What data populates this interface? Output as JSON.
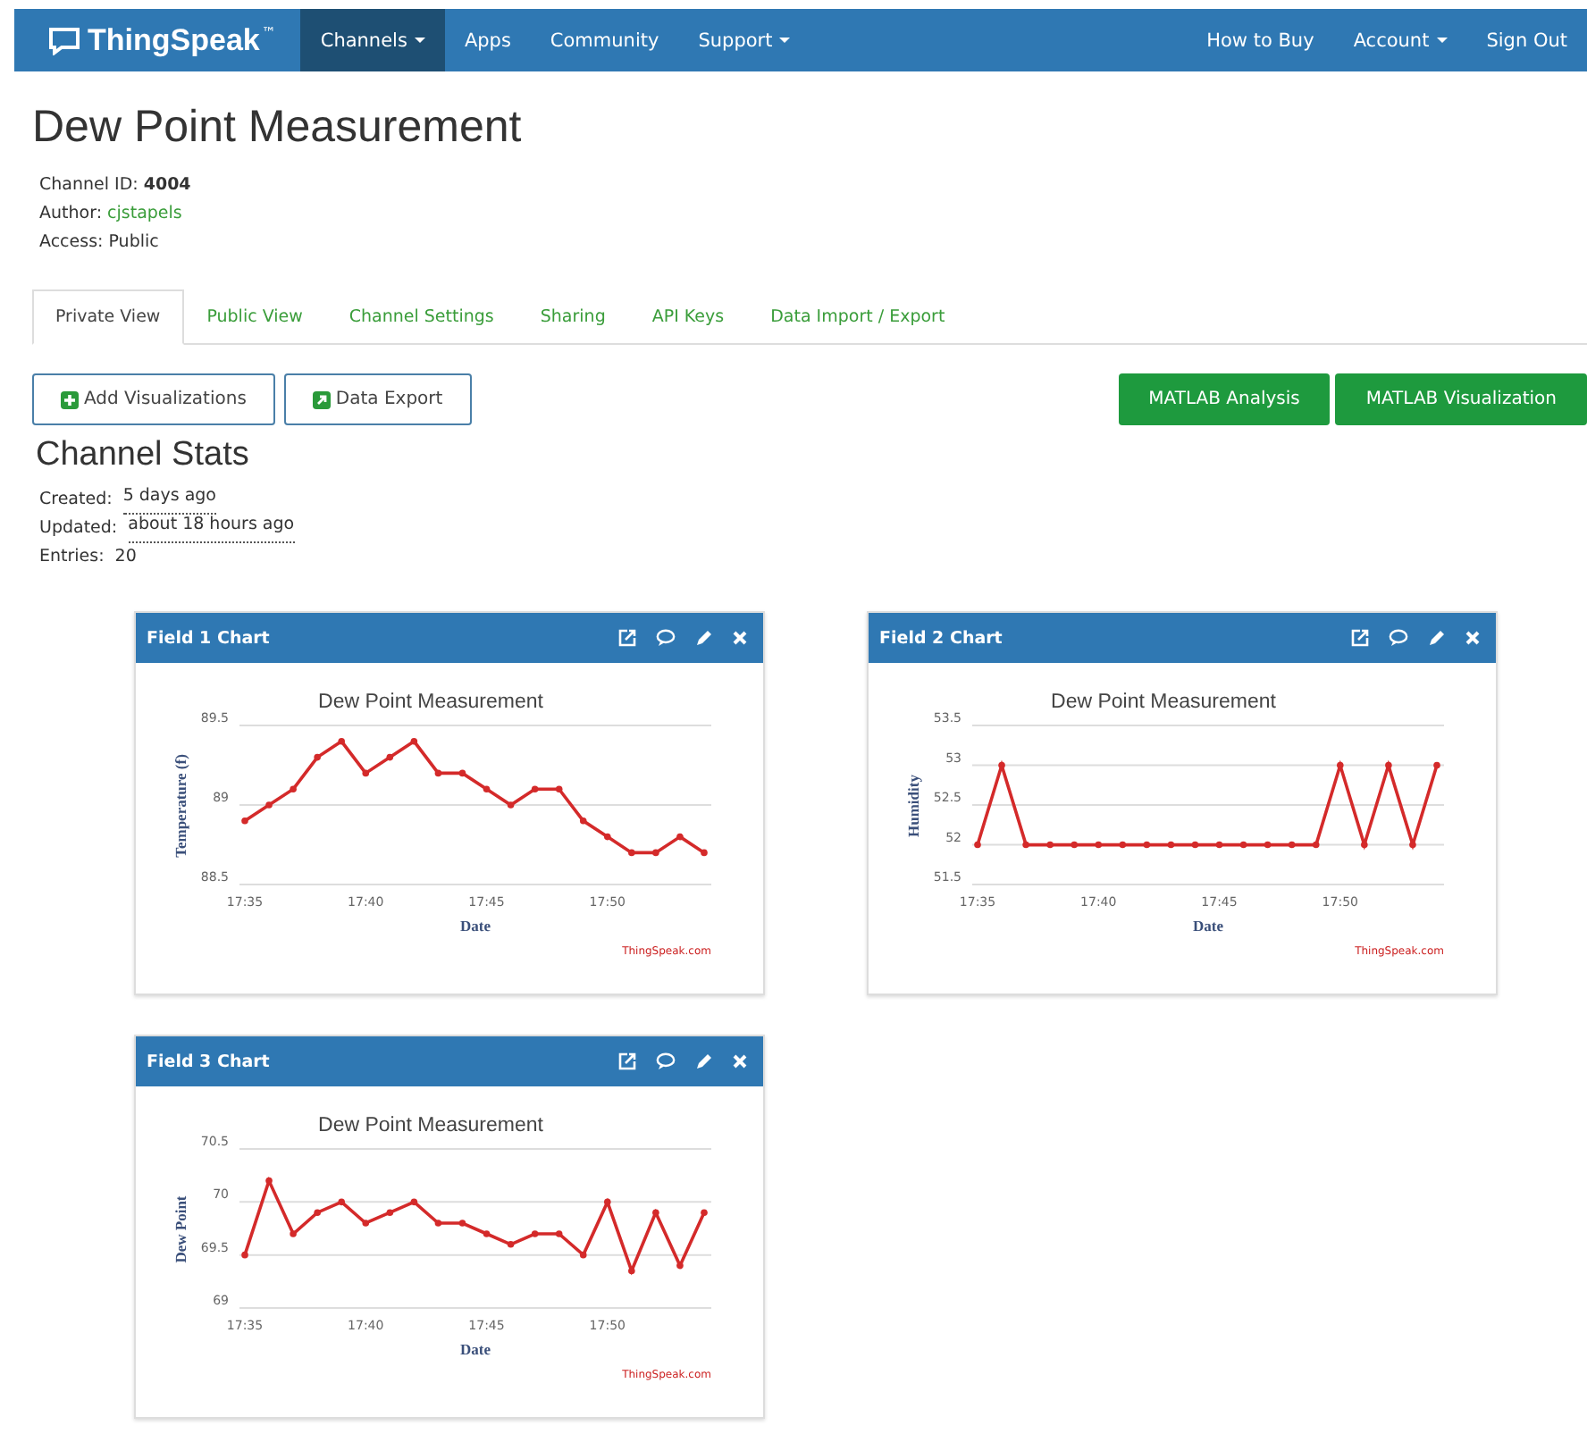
{
  "navbar": {
    "logo": "ThingSpeak",
    "trademark": "™",
    "items": [
      {
        "label": "Channels",
        "dropdown": true,
        "selected": true
      },
      {
        "label": "Apps",
        "dropdown": false,
        "selected": false
      },
      {
        "label": "Community",
        "dropdown": false,
        "selected": false
      },
      {
        "label": "Support",
        "dropdown": true,
        "selected": false
      }
    ],
    "right_items": [
      {
        "label": "How to Buy",
        "dropdown": false
      },
      {
        "label": "Account",
        "dropdown": true
      },
      {
        "label": "Sign Out",
        "dropdown": false
      }
    ]
  },
  "channel": {
    "title": "Dew Point Measurement",
    "meta": [
      {
        "label": "Channel ID:",
        "value": "4004",
        "kind": "bold"
      },
      {
        "label": "Author:",
        "value": "cjstapels",
        "kind": "link"
      },
      {
        "label": "Access:",
        "value": "Public",
        "kind": "plain"
      }
    ]
  },
  "tabs": [
    {
      "label": "Private View",
      "selected": true
    },
    {
      "label": "Public View",
      "selected": false
    },
    {
      "label": "Channel Settings",
      "selected": false
    },
    {
      "label": "Sharing",
      "selected": false
    },
    {
      "label": "API Keys",
      "selected": false
    },
    {
      "label": "Data Import / Export",
      "selected": false
    }
  ],
  "buttons": [
    {
      "label": "Add Visualizations",
      "kind": "plus"
    },
    {
      "label": "Data Export",
      "kind": "export"
    }
  ],
  "matlab_buttons": [
    "MATLAB Analysis",
    "MATLAB Visualization"
  ],
  "stats": {
    "title": "Channel Stats",
    "rows": [
      {
        "label": "Created:",
        "value": "5 days ago",
        "kind": "time"
      },
      {
        "label": "Updated:",
        "value": "about 18 hours ago",
        "kind": "time"
      },
      {
        "label": "Entries:",
        "value": "20",
        "kind": "plain"
      }
    ]
  },
  "panels": [
    {
      "title": "Field 1 Chart",
      "credit": "ThingSpeak.com",
      "chart_data": {
        "type": "line",
        "title": "Dew Point Measurement",
        "xlabel": "Date",
        "ylabel": "Temperature (f)",
        "categories": [
          "17:35",
          null,
          null,
          null,
          null,
          "17:40",
          null,
          null,
          null,
          null,
          "17:45",
          null,
          null,
          null,
          null,
          "17:50",
          null,
          null,
          null,
          null
        ],
        "grid": true,
        "ylim": [
          88.5,
          89.5
        ],
        "yticks": [
          88.5,
          89,
          89.5
        ],
        "series": [
          {
            "color": "#d42a2a",
            "marker": true,
            "values": [
              88.9,
              89.0,
              89.1,
              89.3,
              89.4,
              89.2,
              89.3,
              89.4,
              89.2,
              89.2,
              89.1,
              89.0,
              89.1,
              89.1,
              88.9,
              88.8,
              88.7,
              88.7,
              88.8,
              88.7
            ]
          }
        ]
      }
    },
    {
      "title": "Field 2 Chart",
      "credit": "ThingSpeak.com",
      "chart_data": {
        "type": "line",
        "title": "Dew Point Measurement",
        "xlabel": "Date",
        "ylabel": "Humidity",
        "categories": [
          "17:35",
          null,
          null,
          null,
          null,
          "17:40",
          null,
          null,
          null,
          null,
          "17:45",
          null,
          null,
          null,
          null,
          "17:50",
          null,
          null,
          null,
          null
        ],
        "grid": true,
        "ylim": [
          51.5,
          53.5
        ],
        "yticks": [
          51.5,
          52,
          52.5,
          53,
          53.5
        ],
        "series": [
          {
            "color": "#d42a2a",
            "marker": true,
            "values": [
              52,
              53,
              52,
              52,
              52,
              52,
              52,
              52,
              52,
              52,
              52,
              52,
              52,
              52,
              52,
              53,
              52,
              53,
              52,
              53
            ]
          }
        ]
      }
    },
    {
      "title": "Field 3 Chart",
      "credit": "ThingSpeak.com",
      "chart_data": {
        "type": "line",
        "title": "Dew Point Measurement",
        "xlabel": "Date",
        "ylabel": "Dew Point",
        "categories": [
          "17:35",
          null,
          null,
          null,
          null,
          "17:40",
          null,
          null,
          null,
          null,
          "17:45",
          null,
          null,
          null,
          null,
          "17:50",
          null,
          null,
          null,
          null
        ],
        "grid": true,
        "ylim": [
          69,
          70.5
        ],
        "yticks": [
          69,
          69.5,
          70,
          70.5
        ],
        "series": [
          {
            "color": "#d42a2a",
            "marker": true,
            "values": [
              69.5,
              70.2,
              69.7,
              69.9,
              70.0,
              69.8,
              69.9,
              70.0,
              69.8,
              69.8,
              69.7,
              69.6,
              69.7,
              69.7,
              69.5,
              70.0,
              69.35,
              69.9,
              69.4,
              69.9
            ]
          }
        ]
      }
    }
  ]
}
